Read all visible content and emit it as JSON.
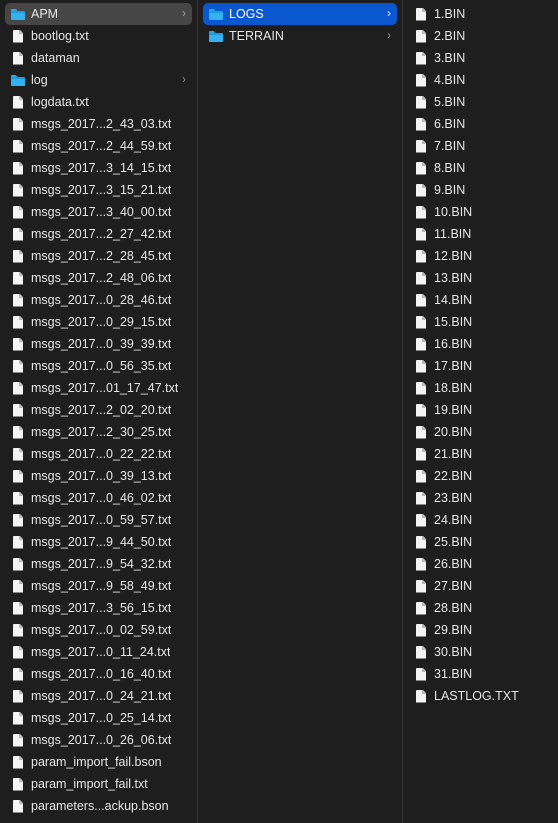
{
  "columns": [
    {
      "items": [
        {
          "label": "APM",
          "icon": "folder-icon",
          "chevron": true,
          "state": "inactive"
        },
        {
          "label": "bootlog.txt",
          "icon": "document-icon"
        },
        {
          "label": "dataman",
          "icon": "document-icon"
        },
        {
          "label": "log",
          "icon": "folder-icon",
          "chevron": true
        },
        {
          "label": "logdata.txt",
          "icon": "document-icon"
        },
        {
          "label": "msgs_2017...2_43_03.txt",
          "icon": "document-icon"
        },
        {
          "label": "msgs_2017...2_44_59.txt",
          "icon": "document-icon"
        },
        {
          "label": "msgs_2017...3_14_15.txt",
          "icon": "document-icon"
        },
        {
          "label": "msgs_2017...3_15_21.txt",
          "icon": "document-icon"
        },
        {
          "label": "msgs_2017...3_40_00.txt",
          "icon": "document-icon"
        },
        {
          "label": "msgs_2017...2_27_42.txt",
          "icon": "document-icon"
        },
        {
          "label": "msgs_2017...2_28_45.txt",
          "icon": "document-icon"
        },
        {
          "label": "msgs_2017...2_48_06.txt",
          "icon": "document-icon"
        },
        {
          "label": "msgs_2017...0_28_46.txt",
          "icon": "document-icon"
        },
        {
          "label": "msgs_2017...0_29_15.txt",
          "icon": "document-icon"
        },
        {
          "label": "msgs_2017...0_39_39.txt",
          "icon": "document-icon"
        },
        {
          "label": "msgs_2017...0_56_35.txt",
          "icon": "document-icon"
        },
        {
          "label": "msgs_2017...01_17_47.txt",
          "icon": "document-icon"
        },
        {
          "label": "msgs_2017...2_02_20.txt",
          "icon": "document-icon"
        },
        {
          "label": "msgs_2017...2_30_25.txt",
          "icon": "document-icon"
        },
        {
          "label": "msgs_2017...0_22_22.txt",
          "icon": "document-icon"
        },
        {
          "label": "msgs_2017...0_39_13.txt",
          "icon": "document-icon"
        },
        {
          "label": "msgs_2017...0_46_02.txt",
          "icon": "document-icon"
        },
        {
          "label": "msgs_2017...0_59_57.txt",
          "icon": "document-icon"
        },
        {
          "label": "msgs_2017...9_44_50.txt",
          "icon": "document-icon"
        },
        {
          "label": "msgs_2017...9_54_32.txt",
          "icon": "document-icon"
        },
        {
          "label": "msgs_2017...9_58_49.txt",
          "icon": "document-icon"
        },
        {
          "label": "msgs_2017...3_56_15.txt",
          "icon": "document-icon"
        },
        {
          "label": "msgs_2017...0_02_59.txt",
          "icon": "document-icon"
        },
        {
          "label": "msgs_2017...0_11_24.txt",
          "icon": "document-icon"
        },
        {
          "label": "msgs_2017...0_16_40.txt",
          "icon": "document-icon"
        },
        {
          "label": "msgs_2017...0_24_21.txt",
          "icon": "document-icon"
        },
        {
          "label": "msgs_2017...0_25_14.txt",
          "icon": "document-icon"
        },
        {
          "label": "msgs_2017...0_26_06.txt",
          "icon": "document-icon"
        },
        {
          "label": "param_import_fail.bson",
          "icon": "document-icon"
        },
        {
          "label": "param_import_fail.txt",
          "icon": "document-icon"
        },
        {
          "label": "parameters...ackup.bson",
          "icon": "document-icon"
        }
      ]
    },
    {
      "items": [
        {
          "label": "LOGS",
          "icon": "folder-icon",
          "chevron": true,
          "state": "active"
        },
        {
          "label": "TERRAIN",
          "icon": "folder-icon",
          "chevron": true
        }
      ]
    },
    {
      "items": [
        {
          "label": "1.BIN",
          "icon": "document-icon"
        },
        {
          "label": "2.BIN",
          "icon": "document-icon"
        },
        {
          "label": "3.BIN",
          "icon": "document-icon"
        },
        {
          "label": "4.BIN",
          "icon": "document-icon"
        },
        {
          "label": "5.BIN",
          "icon": "document-icon"
        },
        {
          "label": "6.BIN",
          "icon": "document-icon"
        },
        {
          "label": "7.BIN",
          "icon": "document-icon"
        },
        {
          "label": "8.BIN",
          "icon": "document-icon"
        },
        {
          "label": "9.BIN",
          "icon": "document-icon"
        },
        {
          "label": "10.BIN",
          "icon": "document-icon"
        },
        {
          "label": "11.BIN",
          "icon": "document-icon"
        },
        {
          "label": "12.BIN",
          "icon": "document-icon"
        },
        {
          "label": "13.BIN",
          "icon": "document-icon"
        },
        {
          "label": "14.BIN",
          "icon": "document-icon"
        },
        {
          "label": "15.BIN",
          "icon": "document-icon"
        },
        {
          "label": "16.BIN",
          "icon": "document-icon"
        },
        {
          "label": "17.BIN",
          "icon": "document-icon"
        },
        {
          "label": "18.BIN",
          "icon": "document-icon"
        },
        {
          "label": "19.BIN",
          "icon": "document-icon"
        },
        {
          "label": "20.BIN",
          "icon": "document-icon"
        },
        {
          "label": "21.BIN",
          "icon": "document-icon"
        },
        {
          "label": "22.BIN",
          "icon": "document-icon"
        },
        {
          "label": "23.BIN",
          "icon": "document-icon"
        },
        {
          "label": "24.BIN",
          "icon": "document-icon"
        },
        {
          "label": "25.BIN",
          "icon": "document-icon"
        },
        {
          "label": "26.BIN",
          "icon": "document-icon"
        },
        {
          "label": "27.BIN",
          "icon": "document-icon"
        },
        {
          "label": "28.BIN",
          "icon": "document-icon"
        },
        {
          "label": "29.BIN",
          "icon": "document-icon"
        },
        {
          "label": "30.BIN",
          "icon": "document-icon"
        },
        {
          "label": "31.BIN",
          "icon": "document-icon"
        },
        {
          "label": "LASTLOG.TXT",
          "icon": "document-icon"
        }
      ]
    }
  ],
  "chevron_glyph": "›",
  "colors": {
    "background": "#1e1e1e",
    "selection_active": "#0b57d0",
    "selection_inactive": "#464646",
    "folder": "#34b2f0",
    "text": "#e6e6e6"
  }
}
